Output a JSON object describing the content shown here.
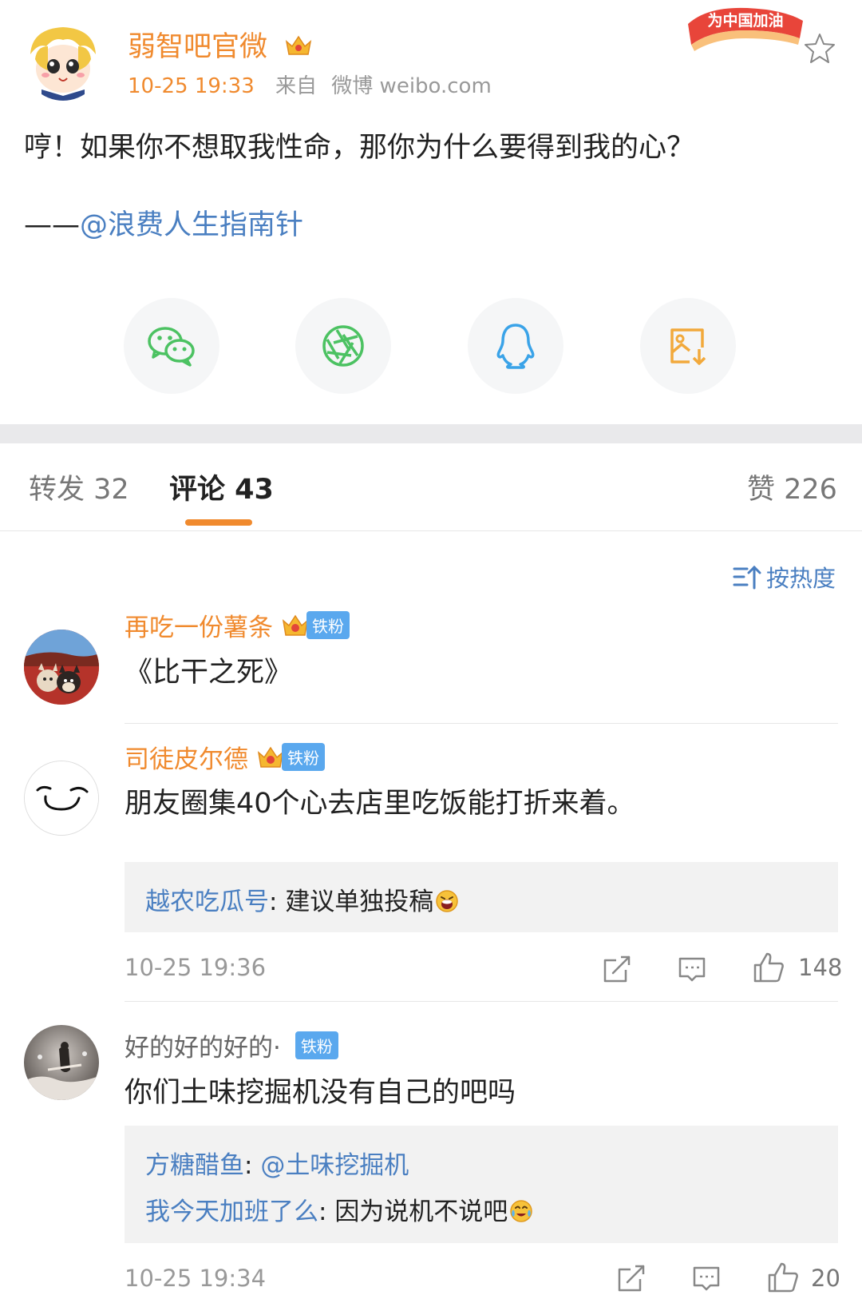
{
  "post": {
    "author": "弱智吧官微",
    "time": "10-25 19:33",
    "source_prefix": "来自",
    "source": "微博 weibo.com",
    "cheer_badge": "为中国加油",
    "text": "哼！如果你不想取我性命，那你为什么要得到我的心？",
    "credit_prefix": "——",
    "credit_mention": "@浪费人生指南针"
  },
  "share": [
    {
      "name": "wechat-icon",
      "color": "#4cc262"
    },
    {
      "name": "moments-icon",
      "color": "#4cc262"
    },
    {
      "name": "qq-icon",
      "color": "#3aa3e8"
    },
    {
      "name": "save-image-icon",
      "color": "#f2a93b"
    }
  ],
  "tabs": {
    "repost": "转发 32",
    "comments": "评论 43",
    "likes": "赞 226"
  },
  "sort_label": "按热度",
  "fan_badge_label": "铁粉",
  "comments": [
    {
      "name": "再吃一份薯条",
      "text": "《比干之死》"
    },
    {
      "name": "司徒皮尔德",
      "text": "朋友圈集40个心去店里吃饭能打折来着。",
      "replies": [
        {
          "name": "越农吃瓜号",
          "sep": ": ",
          "text": "建议单独投稿"
        }
      ],
      "time": "10-25 19:36",
      "likes": "148"
    },
    {
      "name": "好的好的好的·",
      "text": "你们土味挖掘机没有自己的吧吗",
      "replies": [
        {
          "name": "方糖醋鱼",
          "sep": ": ",
          "mention": "@土味挖掘机",
          "text": ""
        },
        {
          "name": "我今天加班了么",
          "sep": ": ",
          "text": "因为说机不说吧"
        }
      ],
      "time": "10-25 19:34",
      "likes": "20"
    }
  ],
  "colors": {
    "accent_orange": "#f08a2e",
    "link_blue": "#4a7fc1",
    "fan_badge_blue": "#5aa8ee"
  }
}
